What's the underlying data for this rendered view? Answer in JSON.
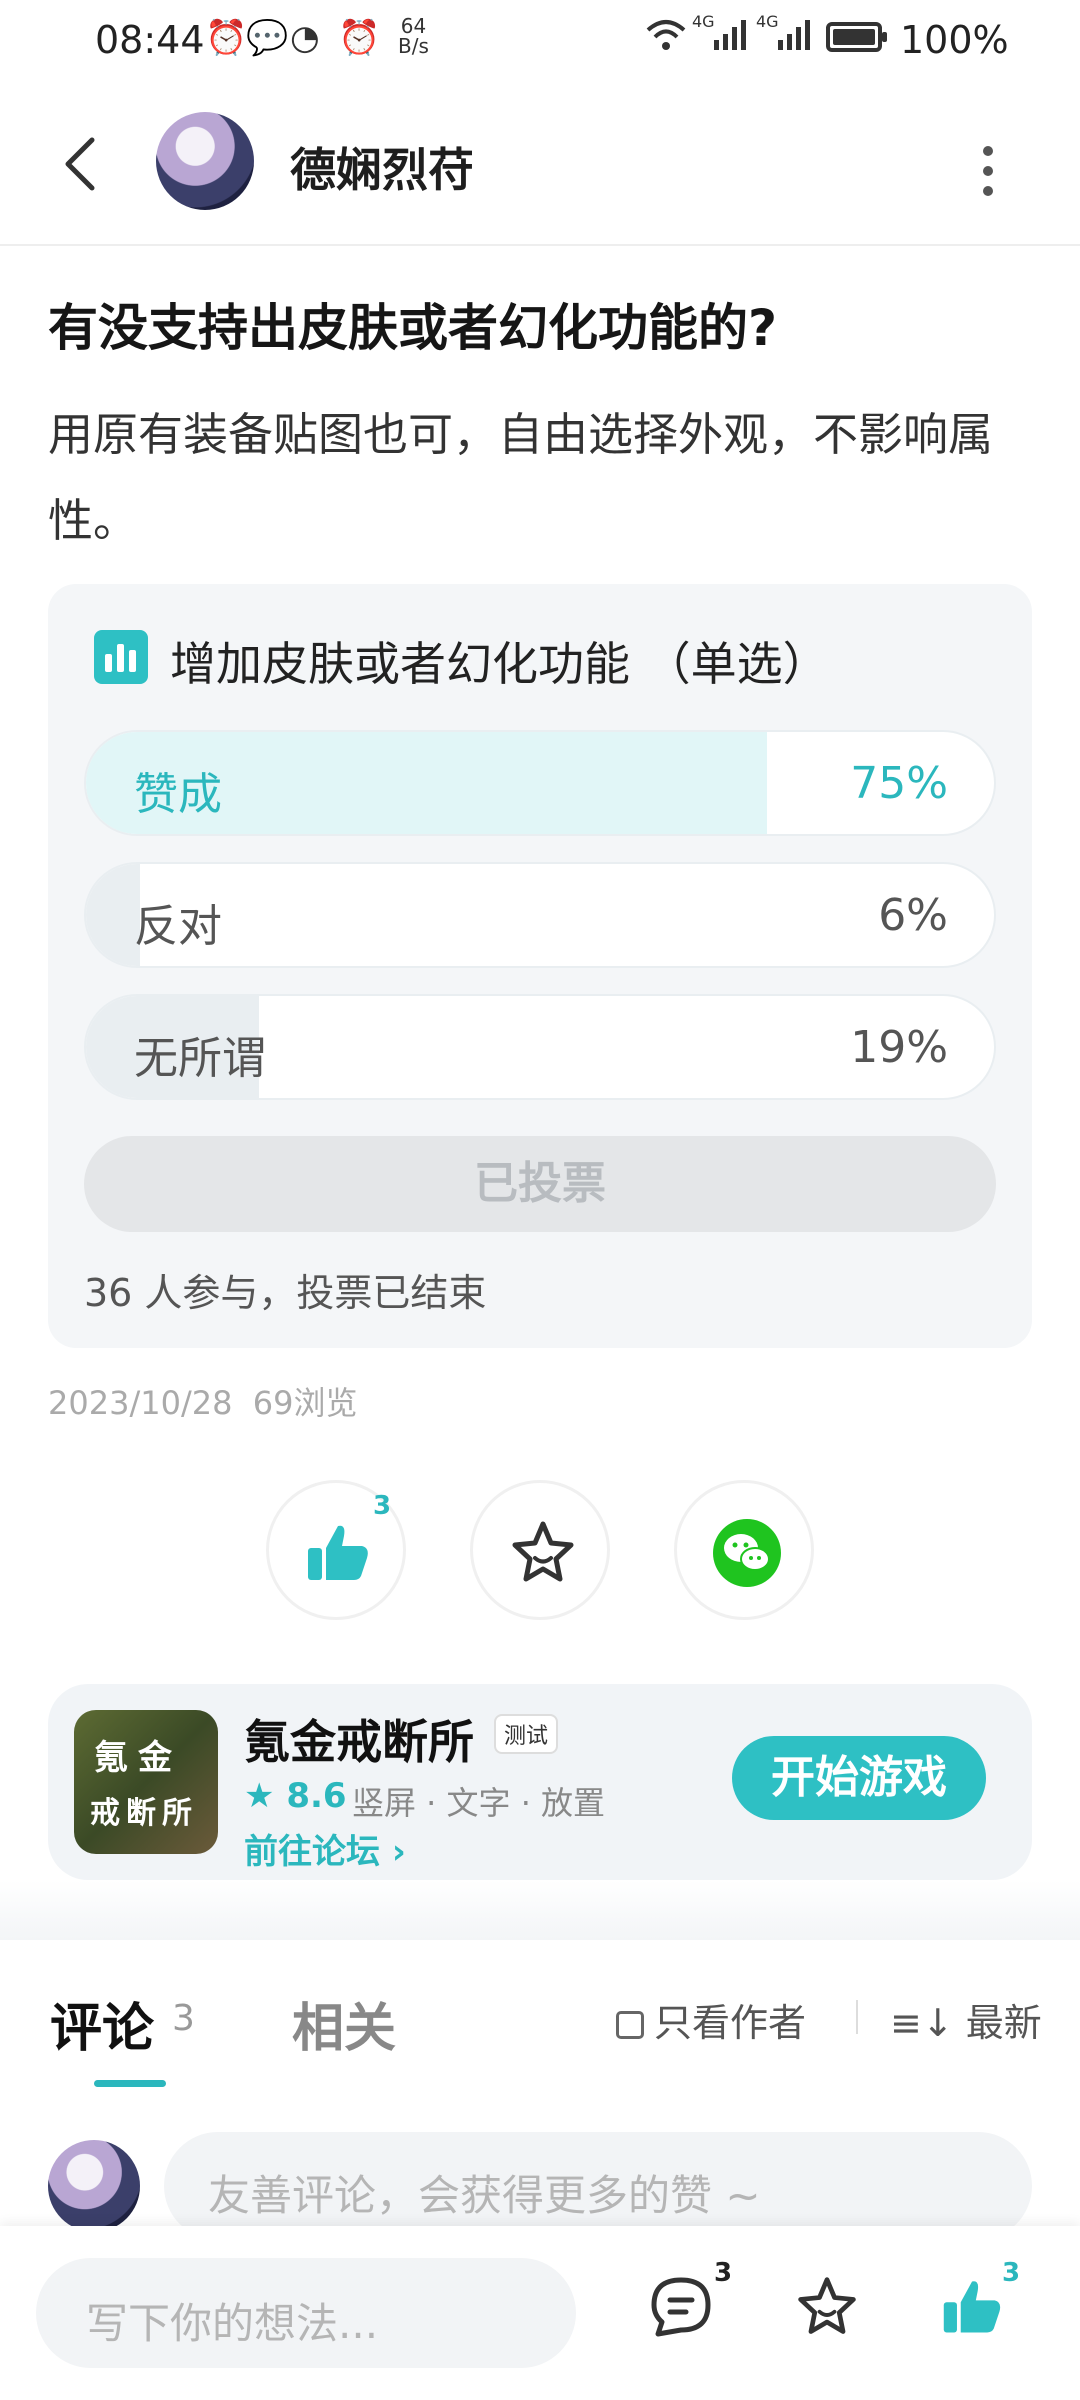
{
  "status_bar": {
    "time": "08:44",
    "net_speed_value": "64",
    "net_speed_unit": "B/s",
    "signal1": "4G",
    "signal2": "4G",
    "battery": "100%"
  },
  "header": {
    "username": "德娴烈苻"
  },
  "post": {
    "title": "有没支持出皮肤或者幻化功能的?",
    "body": "用原有装备贴图也可，自由选择外观，不影响属性。",
    "date": "2023/10/28",
    "views": "69浏览"
  },
  "poll": {
    "title": "增加皮肤或者幻化功能 （单选）",
    "options": [
      {
        "label": "赞成",
        "percent_text": "75%",
        "fraction": 0.75,
        "winner": true
      },
      {
        "label": "反对",
        "percent_text": "6%",
        "fraction": 0.06,
        "winner": false
      },
      {
        "label": "无所谓",
        "percent_text": "19%",
        "fraction": 0.19,
        "winner": false
      }
    ],
    "voted_label": "已投票",
    "footer": "36 人参与，投票已结束"
  },
  "actions": {
    "like_count": "3"
  },
  "game_card": {
    "icon_line1": "氪金",
    "icon_line2": "戒断所",
    "name": "氪金戒断所",
    "tag": "测试",
    "rating": "8.6",
    "tags": "竖屏 · 文字 · 放置",
    "forum_link": "前往论坛",
    "play_button": "开始游戏"
  },
  "tabs": {
    "comments_label": "评论",
    "comments_count": "3",
    "related_label": "相关",
    "author_only": "只看作者",
    "sort": "最新"
  },
  "comment_box": {
    "placeholder": "友善评论，会获得更多的赞 ~"
  },
  "bottom_bar": {
    "placeholder": "写下你的想法...",
    "comment_count": "3",
    "like_count": "3"
  },
  "colors": {
    "accent": "#2ec0c4",
    "wechat": "#1fc41f"
  }
}
